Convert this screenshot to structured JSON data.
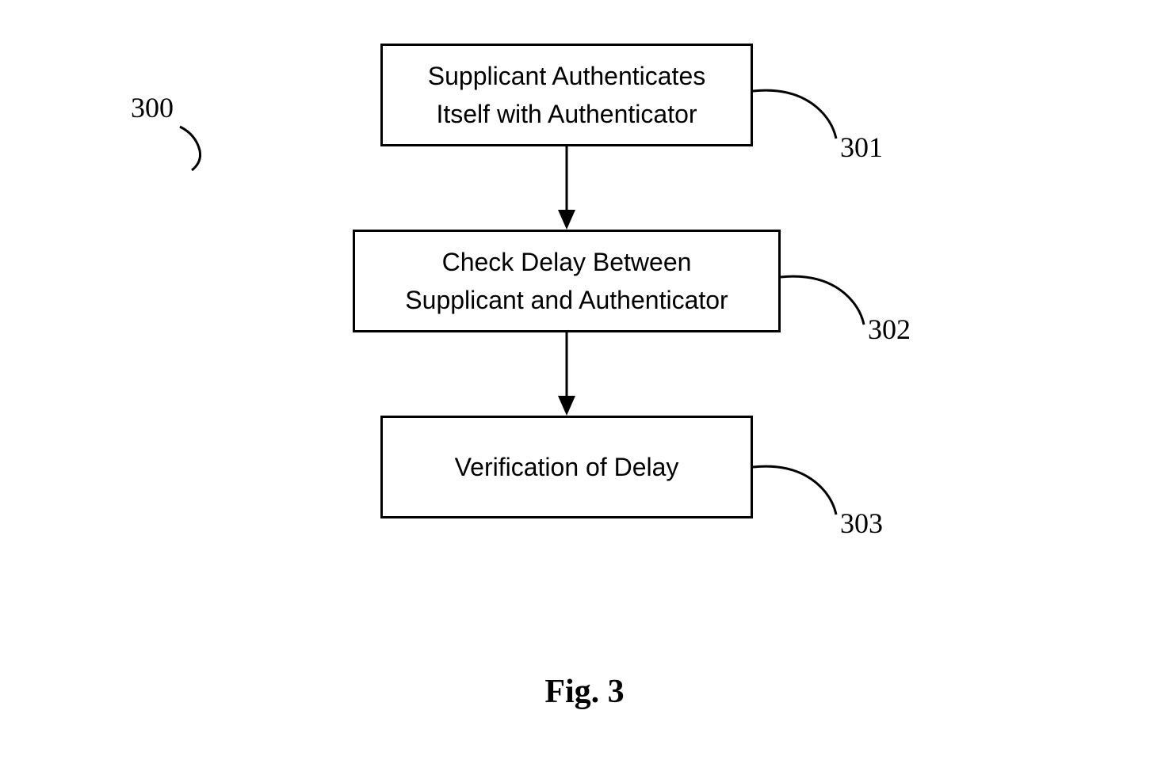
{
  "chart_data": {
    "type": "flowchart",
    "figure_label": "Fig. 3",
    "diagram_number": "300",
    "nodes": [
      {
        "id": "301",
        "text": "Supplicant Authenticates Itself with Authenticator"
      },
      {
        "id": "302",
        "text": "Check Delay Between Supplicant and Authenticator"
      },
      {
        "id": "303",
        "text": "Verification of Delay"
      }
    ],
    "edges": [
      {
        "from": "301",
        "to": "302"
      },
      {
        "from": "302",
        "to": "303"
      }
    ]
  },
  "labels": {
    "diagram": "300",
    "n1": "301",
    "n2": "302",
    "n3": "303"
  },
  "boxes": {
    "b1": "Supplicant Authenticates\nItself with Authenticator",
    "b2": "Check Delay Between\nSupplicant and Authenticator",
    "b3": "Verification of Delay"
  },
  "caption": "Fig. 3"
}
